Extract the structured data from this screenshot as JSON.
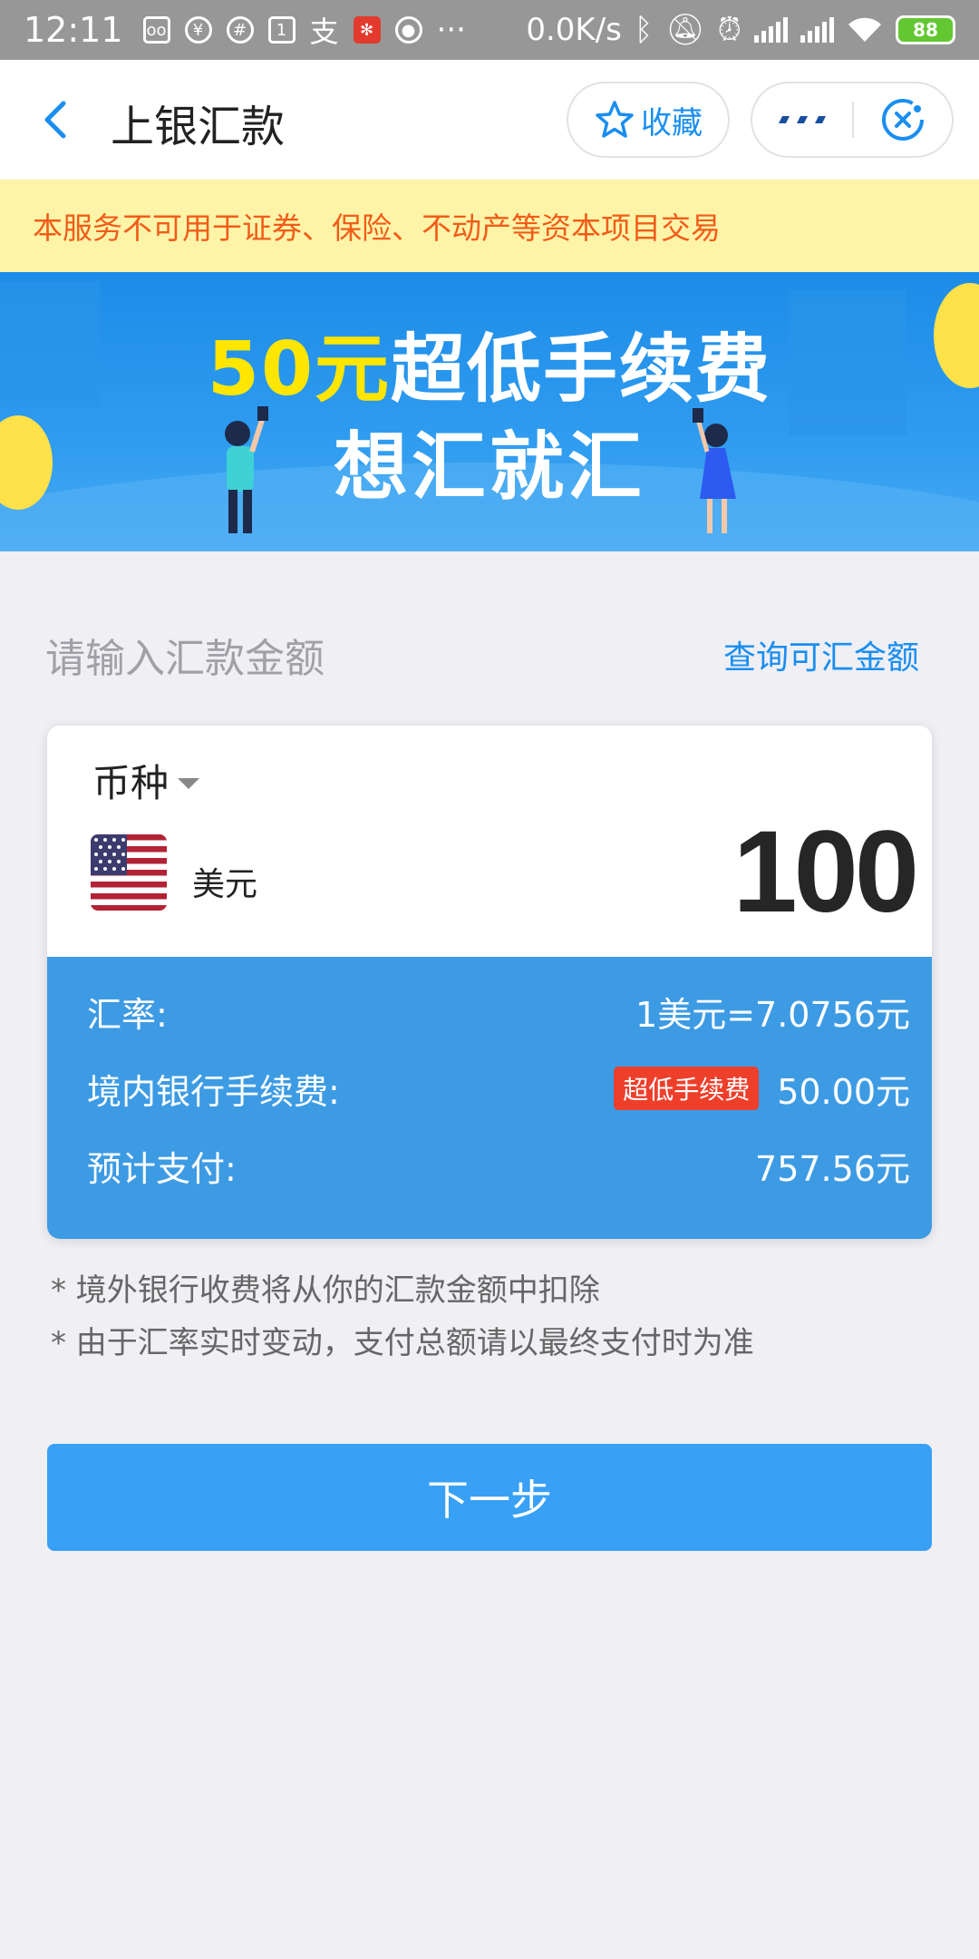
{
  "status_bar": {
    "time": "12:11",
    "net_speed": "0.0K/s",
    "battery": "88"
  },
  "nav": {
    "title": "上银汇款",
    "favorite_label": "收藏"
  },
  "notice": {
    "text": "本服务不可用于证券、保险、不动产等资本项目交易"
  },
  "banner": {
    "highlight": "50元",
    "line1_rest": "超低手续费",
    "line2": "想汇就汇"
  },
  "section": {
    "label": "请输入汇款金额",
    "link": "查询可汇金额"
  },
  "card": {
    "currency_label": "币种",
    "currency_name": "美元",
    "amount": "100",
    "rows": [
      {
        "label": "汇率:",
        "value": "1美元=7.0756元"
      },
      {
        "label": "境内银行手续费:",
        "tag": "超低手续费",
        "value": "50.00元"
      },
      {
        "label": "预计支付:",
        "value": "757.56元"
      }
    ]
  },
  "notes": [
    "* 境外银行收费将从你的汇款金额中扣除",
    "* 由于汇率实时变动，支付总额请以最终支付时为准"
  ],
  "next_button": "下一步",
  "colors": {
    "accent": "#1a8ef0",
    "button": "#38a0f5",
    "card_blue": "#3d9be4",
    "notice_bg": "#fdf4a8",
    "notice_text": "#f25c19",
    "tag_red": "#ee3f2b"
  }
}
